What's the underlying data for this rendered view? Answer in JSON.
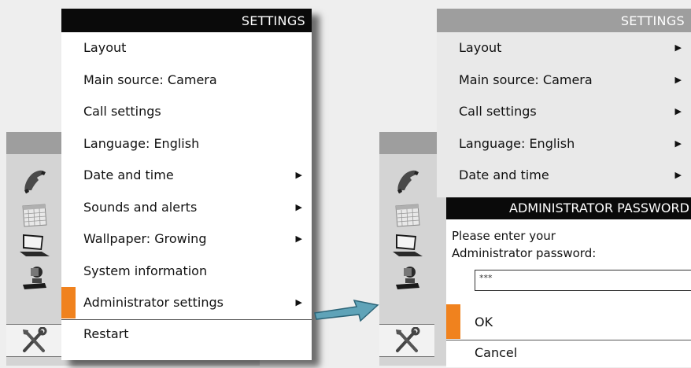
{
  "left_menu": {
    "title": "SETTINGS",
    "items": [
      {
        "label": "Layout",
        "arrow": ""
      },
      {
        "label": "Main source: Camera",
        "arrow": ""
      },
      {
        "label": "Call settings",
        "arrow": ""
      },
      {
        "label": "Language: English",
        "arrow": ""
      },
      {
        "label": "Date and time",
        "arrow": "▶"
      },
      {
        "label": "Sounds and alerts",
        "arrow": "▶"
      },
      {
        "label": "Wallpaper: Growing",
        "arrow": "▶"
      },
      {
        "label": "System information",
        "arrow": ""
      },
      {
        "label": "Administrator settings",
        "arrow": "▶"
      },
      {
        "label": "Restart",
        "arrow": ""
      }
    ]
  },
  "right_menu": {
    "title": "SETTINGS",
    "items": [
      {
        "label": "Layout",
        "arrow": "▶"
      },
      {
        "label": "Main source: Camera",
        "arrow": "▶"
      },
      {
        "label": "Call settings",
        "arrow": "▶"
      },
      {
        "label": "Language: English",
        "arrow": "▶"
      },
      {
        "label": "Date and time",
        "arrow": "▶"
      }
    ]
  },
  "password_dialog": {
    "title": "ADMINISTRATOR PASSWORD",
    "prompt_line1": "Please enter your",
    "prompt_line2": "Administrator password:",
    "password_value": "***",
    "ok_label": "OK",
    "cancel_label": "Cancel"
  },
  "icons": [
    "phone-icon",
    "calendar-icon",
    "laptop-icon",
    "camera-icon",
    "tools-icon"
  ],
  "colors": {
    "accent": "#f0821e",
    "header_dark": "#0a0a0a",
    "header_gray": "#9e9e9e"
  }
}
